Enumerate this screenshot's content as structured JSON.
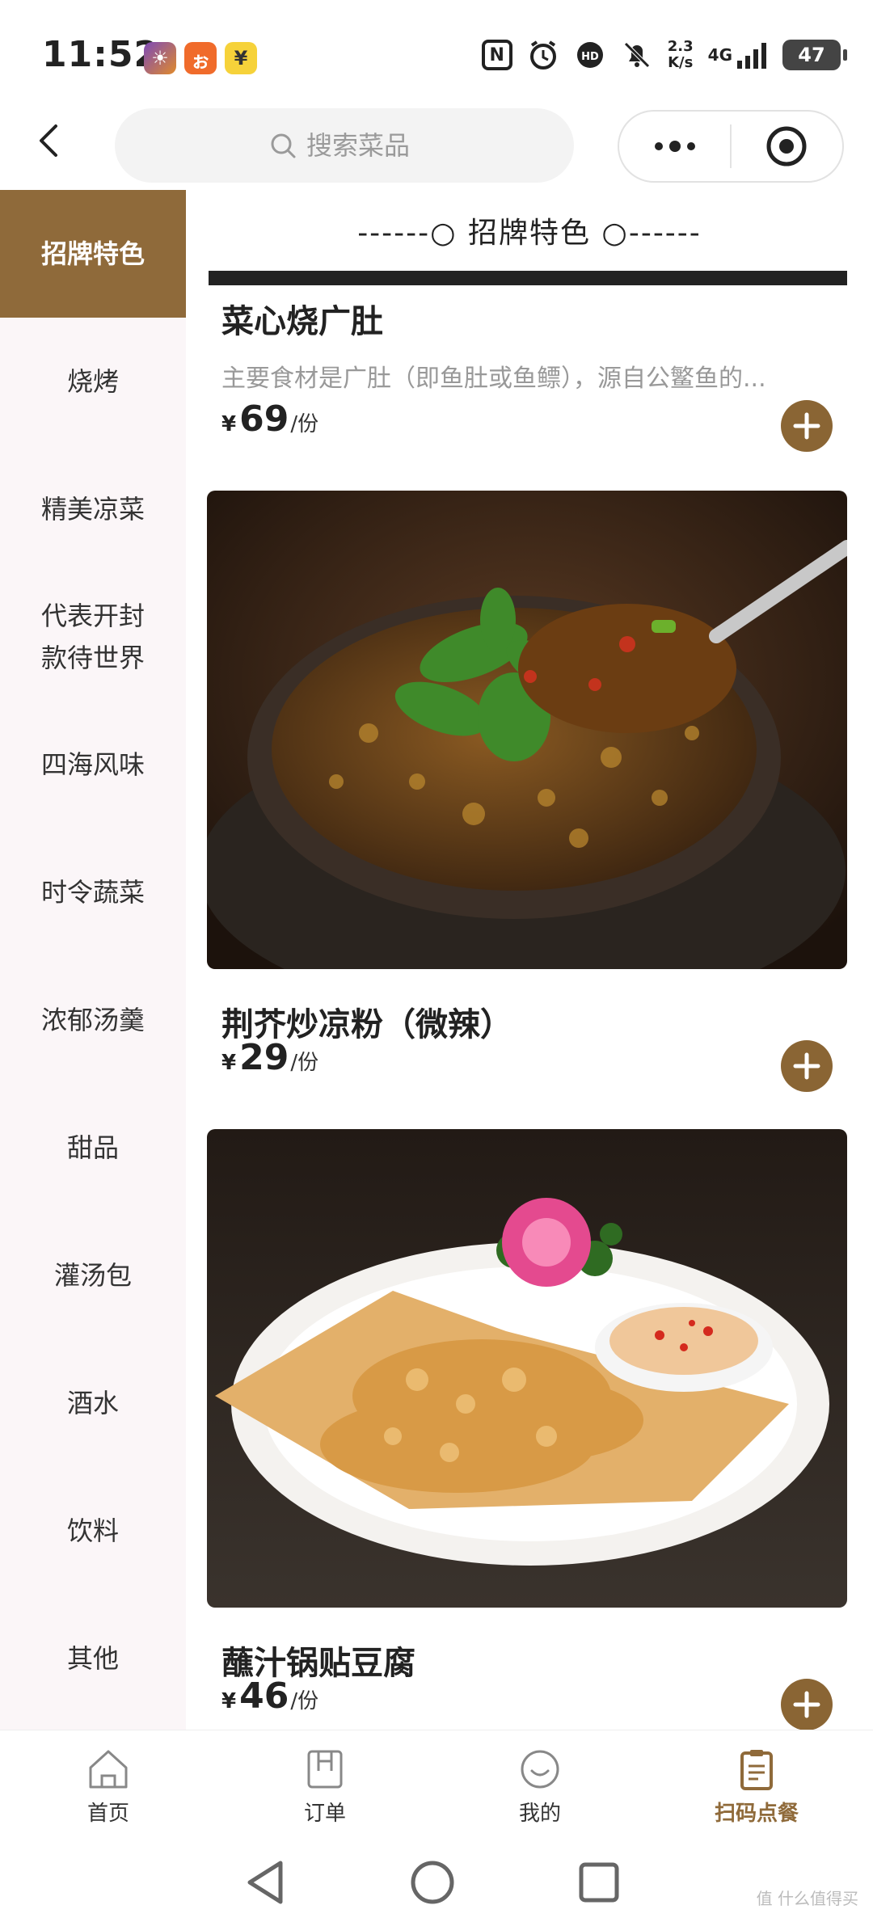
{
  "status_bar": {
    "time": "11:52",
    "net_speed_value": "2.3",
    "net_speed_unit": "K/s",
    "network": "4G",
    "battery": "47"
  },
  "header": {
    "search_placeholder": "搜索菜品",
    "menu_icon": "more-dots-icon",
    "close_icon": "target-circle-icon"
  },
  "sidebar": {
    "items": [
      {
        "label": "招牌特色",
        "active": true
      },
      {
        "label": "烧烤"
      },
      {
        "label": "精美凉菜"
      },
      {
        "label": "代表开封款待世界"
      },
      {
        "label": "四海风味"
      },
      {
        "label": "时令蔬菜"
      },
      {
        "label": "浓郁汤羹"
      },
      {
        "label": "甜品"
      },
      {
        "label": "灌汤包"
      },
      {
        "label": "酒水"
      },
      {
        "label": "饮料"
      },
      {
        "label": "其他"
      }
    ]
  },
  "main": {
    "section_title": "------○ 招牌特色 ○------",
    "dishes": [
      {
        "name": "菜心烧广肚",
        "desc": "主要食材是广肚（即鱼肚或鱼鳔），源自公鳘鱼的...",
        "currency": "¥",
        "price": "69",
        "unit": "/份"
      },
      {
        "name": "荆芥炒凉粉（微辣）",
        "currency": "¥",
        "price": "29",
        "unit": "/份"
      },
      {
        "name": "蘸汁锅贴豆腐",
        "currency": "¥",
        "price": "46",
        "unit": "/份"
      }
    ]
  },
  "tabbar": {
    "tabs": [
      {
        "label": "首页",
        "icon": "home-icon"
      },
      {
        "label": "订单",
        "icon": "order-icon"
      },
      {
        "label": "我的",
        "icon": "profile-icon"
      },
      {
        "label": "扫码点餐",
        "icon": "clipboard-icon",
        "active": true
      }
    ]
  },
  "watermark": "值 什么值得买",
  "colors": {
    "accent": "#8f6a3a",
    "sidebar_bg": "#fbf6f8"
  }
}
